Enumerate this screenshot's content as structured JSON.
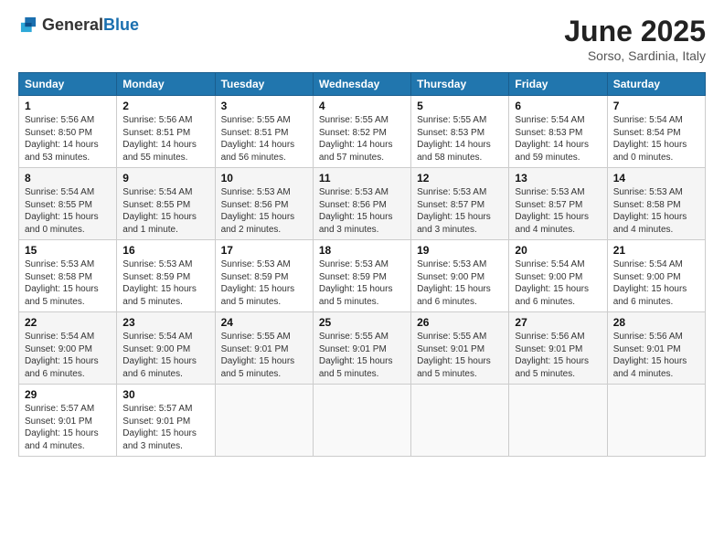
{
  "header": {
    "logo_general": "General",
    "logo_blue": "Blue",
    "title": "June 2025",
    "subtitle": "Sorso, Sardinia, Italy"
  },
  "columns": [
    "Sunday",
    "Monday",
    "Tuesday",
    "Wednesday",
    "Thursday",
    "Friday",
    "Saturday"
  ],
  "weeks": [
    [
      {
        "day": "1",
        "sunrise": "Sunrise: 5:56 AM",
        "sunset": "Sunset: 8:50 PM",
        "daylight": "Daylight: 14 hours and 53 minutes."
      },
      {
        "day": "2",
        "sunrise": "Sunrise: 5:56 AM",
        "sunset": "Sunset: 8:51 PM",
        "daylight": "Daylight: 14 hours and 55 minutes."
      },
      {
        "day": "3",
        "sunrise": "Sunrise: 5:55 AM",
        "sunset": "Sunset: 8:51 PM",
        "daylight": "Daylight: 14 hours and 56 minutes."
      },
      {
        "day": "4",
        "sunrise": "Sunrise: 5:55 AM",
        "sunset": "Sunset: 8:52 PM",
        "daylight": "Daylight: 14 hours and 57 minutes."
      },
      {
        "day": "5",
        "sunrise": "Sunrise: 5:55 AM",
        "sunset": "Sunset: 8:53 PM",
        "daylight": "Daylight: 14 hours and 58 minutes."
      },
      {
        "day": "6",
        "sunrise": "Sunrise: 5:54 AM",
        "sunset": "Sunset: 8:53 PM",
        "daylight": "Daylight: 14 hours and 59 minutes."
      },
      {
        "day": "7",
        "sunrise": "Sunrise: 5:54 AM",
        "sunset": "Sunset: 8:54 PM",
        "daylight": "Daylight: 15 hours and 0 minutes."
      }
    ],
    [
      {
        "day": "8",
        "sunrise": "Sunrise: 5:54 AM",
        "sunset": "Sunset: 8:55 PM",
        "daylight": "Daylight: 15 hours and 0 minutes."
      },
      {
        "day": "9",
        "sunrise": "Sunrise: 5:54 AM",
        "sunset": "Sunset: 8:55 PM",
        "daylight": "Daylight: 15 hours and 1 minute."
      },
      {
        "day": "10",
        "sunrise": "Sunrise: 5:53 AM",
        "sunset": "Sunset: 8:56 PM",
        "daylight": "Daylight: 15 hours and 2 minutes."
      },
      {
        "day": "11",
        "sunrise": "Sunrise: 5:53 AM",
        "sunset": "Sunset: 8:56 PM",
        "daylight": "Daylight: 15 hours and 3 minutes."
      },
      {
        "day": "12",
        "sunrise": "Sunrise: 5:53 AM",
        "sunset": "Sunset: 8:57 PM",
        "daylight": "Daylight: 15 hours and 3 minutes."
      },
      {
        "day": "13",
        "sunrise": "Sunrise: 5:53 AM",
        "sunset": "Sunset: 8:57 PM",
        "daylight": "Daylight: 15 hours and 4 minutes."
      },
      {
        "day": "14",
        "sunrise": "Sunrise: 5:53 AM",
        "sunset": "Sunset: 8:58 PM",
        "daylight": "Daylight: 15 hours and 4 minutes."
      }
    ],
    [
      {
        "day": "15",
        "sunrise": "Sunrise: 5:53 AM",
        "sunset": "Sunset: 8:58 PM",
        "daylight": "Daylight: 15 hours and 5 minutes."
      },
      {
        "day": "16",
        "sunrise": "Sunrise: 5:53 AM",
        "sunset": "Sunset: 8:59 PM",
        "daylight": "Daylight: 15 hours and 5 minutes."
      },
      {
        "day": "17",
        "sunrise": "Sunrise: 5:53 AM",
        "sunset": "Sunset: 8:59 PM",
        "daylight": "Daylight: 15 hours and 5 minutes."
      },
      {
        "day": "18",
        "sunrise": "Sunrise: 5:53 AM",
        "sunset": "Sunset: 8:59 PM",
        "daylight": "Daylight: 15 hours and 5 minutes."
      },
      {
        "day": "19",
        "sunrise": "Sunrise: 5:53 AM",
        "sunset": "Sunset: 9:00 PM",
        "daylight": "Daylight: 15 hours and 6 minutes."
      },
      {
        "day": "20",
        "sunrise": "Sunrise: 5:54 AM",
        "sunset": "Sunset: 9:00 PM",
        "daylight": "Daylight: 15 hours and 6 minutes."
      },
      {
        "day": "21",
        "sunrise": "Sunrise: 5:54 AM",
        "sunset": "Sunset: 9:00 PM",
        "daylight": "Daylight: 15 hours and 6 minutes."
      }
    ],
    [
      {
        "day": "22",
        "sunrise": "Sunrise: 5:54 AM",
        "sunset": "Sunset: 9:00 PM",
        "daylight": "Daylight: 15 hours and 6 minutes."
      },
      {
        "day": "23",
        "sunrise": "Sunrise: 5:54 AM",
        "sunset": "Sunset: 9:00 PM",
        "daylight": "Daylight: 15 hours and 6 minutes."
      },
      {
        "day": "24",
        "sunrise": "Sunrise: 5:55 AM",
        "sunset": "Sunset: 9:01 PM",
        "daylight": "Daylight: 15 hours and 5 minutes."
      },
      {
        "day": "25",
        "sunrise": "Sunrise: 5:55 AM",
        "sunset": "Sunset: 9:01 PM",
        "daylight": "Daylight: 15 hours and 5 minutes."
      },
      {
        "day": "26",
        "sunrise": "Sunrise: 5:55 AM",
        "sunset": "Sunset: 9:01 PM",
        "daylight": "Daylight: 15 hours and 5 minutes."
      },
      {
        "day": "27",
        "sunrise": "Sunrise: 5:56 AM",
        "sunset": "Sunset: 9:01 PM",
        "daylight": "Daylight: 15 hours and 5 minutes."
      },
      {
        "day": "28",
        "sunrise": "Sunrise: 5:56 AM",
        "sunset": "Sunset: 9:01 PM",
        "daylight": "Daylight: 15 hours and 4 minutes."
      }
    ],
    [
      {
        "day": "29",
        "sunrise": "Sunrise: 5:57 AM",
        "sunset": "Sunset: 9:01 PM",
        "daylight": "Daylight: 15 hours and 4 minutes."
      },
      {
        "day": "30",
        "sunrise": "Sunrise: 5:57 AM",
        "sunset": "Sunset: 9:01 PM",
        "daylight": "Daylight: 15 hours and 3 minutes."
      },
      null,
      null,
      null,
      null,
      null
    ]
  ]
}
